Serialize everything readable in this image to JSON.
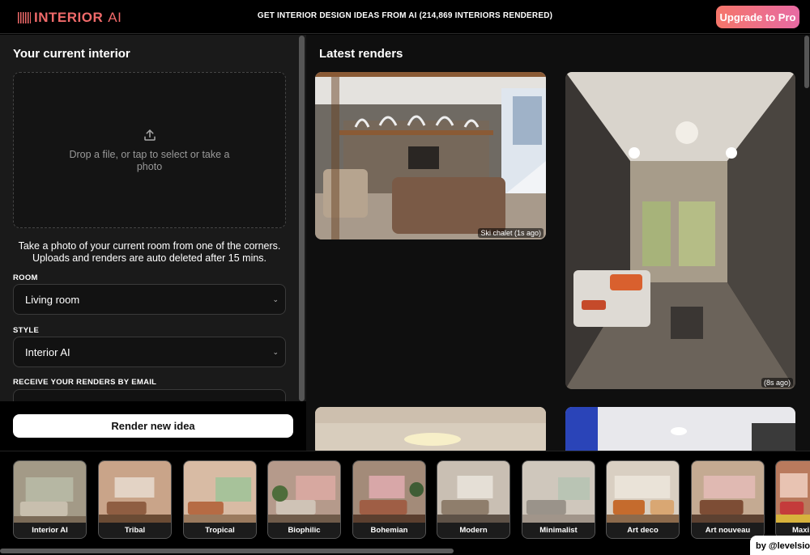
{
  "header": {
    "logo_text": "INTERIOR",
    "logo_suffix": "AI",
    "tagline": "GET INTERIOR DESIGN IDEAS FROM AI (214,869 INTERIORS RENDERED)",
    "upgrade_label": "Upgrade to Pro"
  },
  "left": {
    "title": "Your current interior",
    "dropzone_text": "Drop a file, or tap to select or take a photo",
    "hint": "Take a photo of your current room from one of the corners. Uploads and renders are auto deleted after 15 mins.",
    "room_label": "ROOM",
    "room_value": "Living room",
    "style_label": "STYLE",
    "style_value": "Interior AI",
    "email_label": "RECEIVE YOUR RENDERS BY EMAIL",
    "render_button": "Render new idea"
  },
  "right": {
    "title": "Latest renders",
    "renders": [
      {
        "caption": "Ski chalet (1s ago)"
      },
      {
        "caption": "(8s ago)"
      }
    ]
  },
  "styles": [
    "Interior AI",
    "Tribal",
    "Tropical",
    "Biophilic",
    "Bohemian",
    "Modern",
    "Minimalist",
    "Art deco",
    "Art nouveau",
    "Maxi"
  ],
  "credit": "by @levelsio",
  "colors": {
    "accent": "#f06a6a",
    "upgrade_gradient_start": "#f5766a",
    "upgrade_gradient_end": "#e76aa3"
  }
}
